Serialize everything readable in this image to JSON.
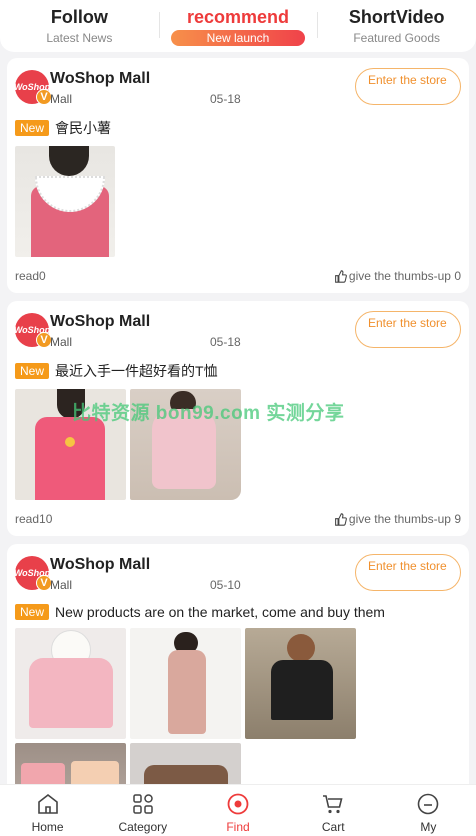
{
  "tabs": [
    {
      "title": "Follow",
      "subtitle": "Latest News"
    },
    {
      "title": "recommend",
      "subtitle": "New launch"
    },
    {
      "title": "ShortVideo",
      "subtitle": "Featured Goods"
    }
  ],
  "colors": {
    "accent": "#ee3b3b",
    "tag": "#f59a1a",
    "enter_border": "#f5b56a",
    "enter_text": "#f0902e"
  },
  "posts": [
    {
      "store_name": "WoShop Mall",
      "store_type": "Mall",
      "avatar_text": "WoShop",
      "badge": "V",
      "date": "05-18",
      "enter_label": "Enter the store",
      "tag": "New",
      "text": "會民小薯",
      "read": "read0",
      "thumbs": "give the thumbs-up 0"
    },
    {
      "store_name": "WoShop Mall",
      "store_type": "Mall",
      "avatar_text": "WoShop",
      "badge": "V",
      "date": "05-18",
      "enter_label": "Enter the store",
      "tag": "New",
      "text": "最近入手一件超好看的T恤",
      "read": "read10",
      "thumbs": "give the thumbs-up 9"
    },
    {
      "store_name": "WoShop Mall",
      "store_type": "Mall",
      "avatar_text": "WoShop",
      "badge": "V",
      "date": "05-10",
      "enter_label": "Enter the store",
      "tag": "New",
      "text": "New products are on the market, come and buy them"
    }
  ],
  "watermark": "比特资源 bon99.com 实测分享",
  "nav": [
    {
      "label": "Home",
      "icon": "home-icon"
    },
    {
      "label": "Category",
      "icon": "category-icon"
    },
    {
      "label": "Find",
      "icon": "find-icon"
    },
    {
      "label": "Cart",
      "icon": "cart-icon"
    },
    {
      "label": "My",
      "icon": "user-icon"
    }
  ]
}
